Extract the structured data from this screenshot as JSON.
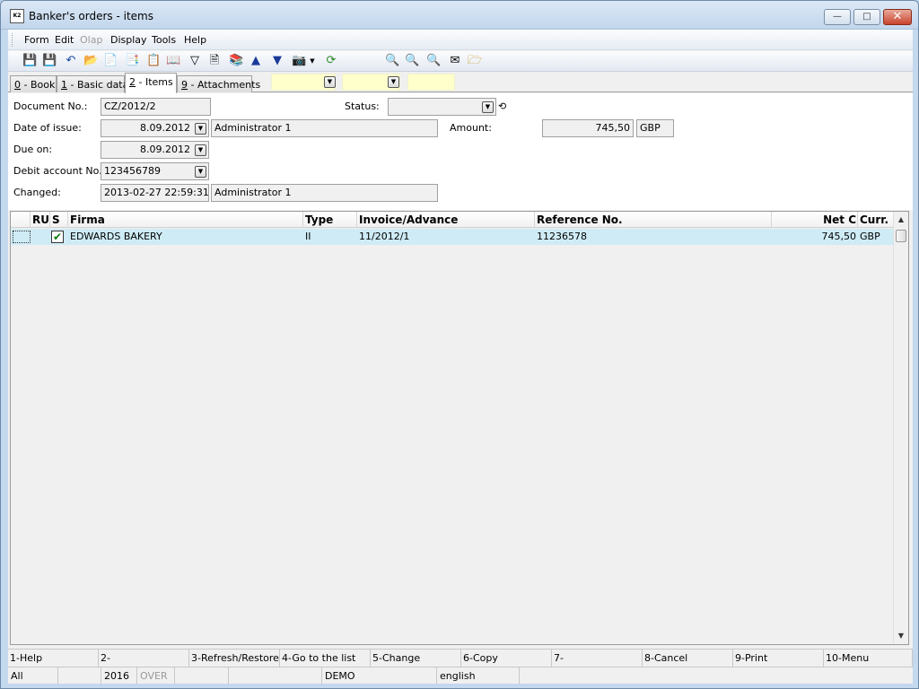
{
  "window": {
    "title": "Banker's orders - items",
    "app_icon_text": "K2"
  },
  "menu": {
    "items": [
      {
        "label": "Form",
        "enabled": true
      },
      {
        "label": "Edit",
        "enabled": true
      },
      {
        "label": "Olap",
        "enabled": false
      },
      {
        "label": "Display",
        "enabled": true
      },
      {
        "label": "Tools",
        "enabled": true
      },
      {
        "label": "Help",
        "enabled": true
      }
    ]
  },
  "tabs": [
    {
      "key": "0",
      "label": " - Book"
    },
    {
      "key": "1",
      "label": " - Basic data"
    },
    {
      "key": "2",
      "label": " - Items"
    },
    {
      "key": "9",
      "label": " - Attachments"
    }
  ],
  "form": {
    "document_no": {
      "label": "Document No.:",
      "value": "CZ/2012/2"
    },
    "status": {
      "label": "Status:",
      "value": ""
    },
    "date_of_issue": {
      "label": "Date of issue:",
      "value": "8.09.2012",
      "user": "Administrator 1"
    },
    "amount": {
      "label": "Amount:",
      "value": "745,50",
      "currency": "GBP"
    },
    "due_on": {
      "label": "Due on:",
      "value": "8.09.2012"
    },
    "debit_account": {
      "label": "Debit account No.:",
      "value": "123456789"
    },
    "changed": {
      "label": "Changed:",
      "value": "2013-02-27 22:59:31",
      "user": "Administrator 1"
    }
  },
  "grid": {
    "columns": [
      "RU",
      "S",
      "Firma",
      "Type",
      "Invoice/Advance",
      "Reference No.",
      "Net C",
      "Curr."
    ],
    "rows": [
      {
        "ru": "",
        "s_checked": true,
        "firma": "EDWARDS BAKERY",
        "type": "II",
        "invoice": "11/2012/1",
        "reference": "11236578",
        "net": "745,50",
        "curr": "GBP"
      }
    ]
  },
  "function_keys": [
    "1-Help",
    "2-",
    "3-Refresh/Restore",
    "4-Go to the list",
    "5-Change",
    "6-Copy",
    "7-",
    "8-Cancel",
    "9-Print",
    "10-Menu"
  ],
  "statusbar": {
    "filter": "All",
    "year": "2016",
    "mode": "OVER",
    "db": "DEMO",
    "language": "english"
  }
}
